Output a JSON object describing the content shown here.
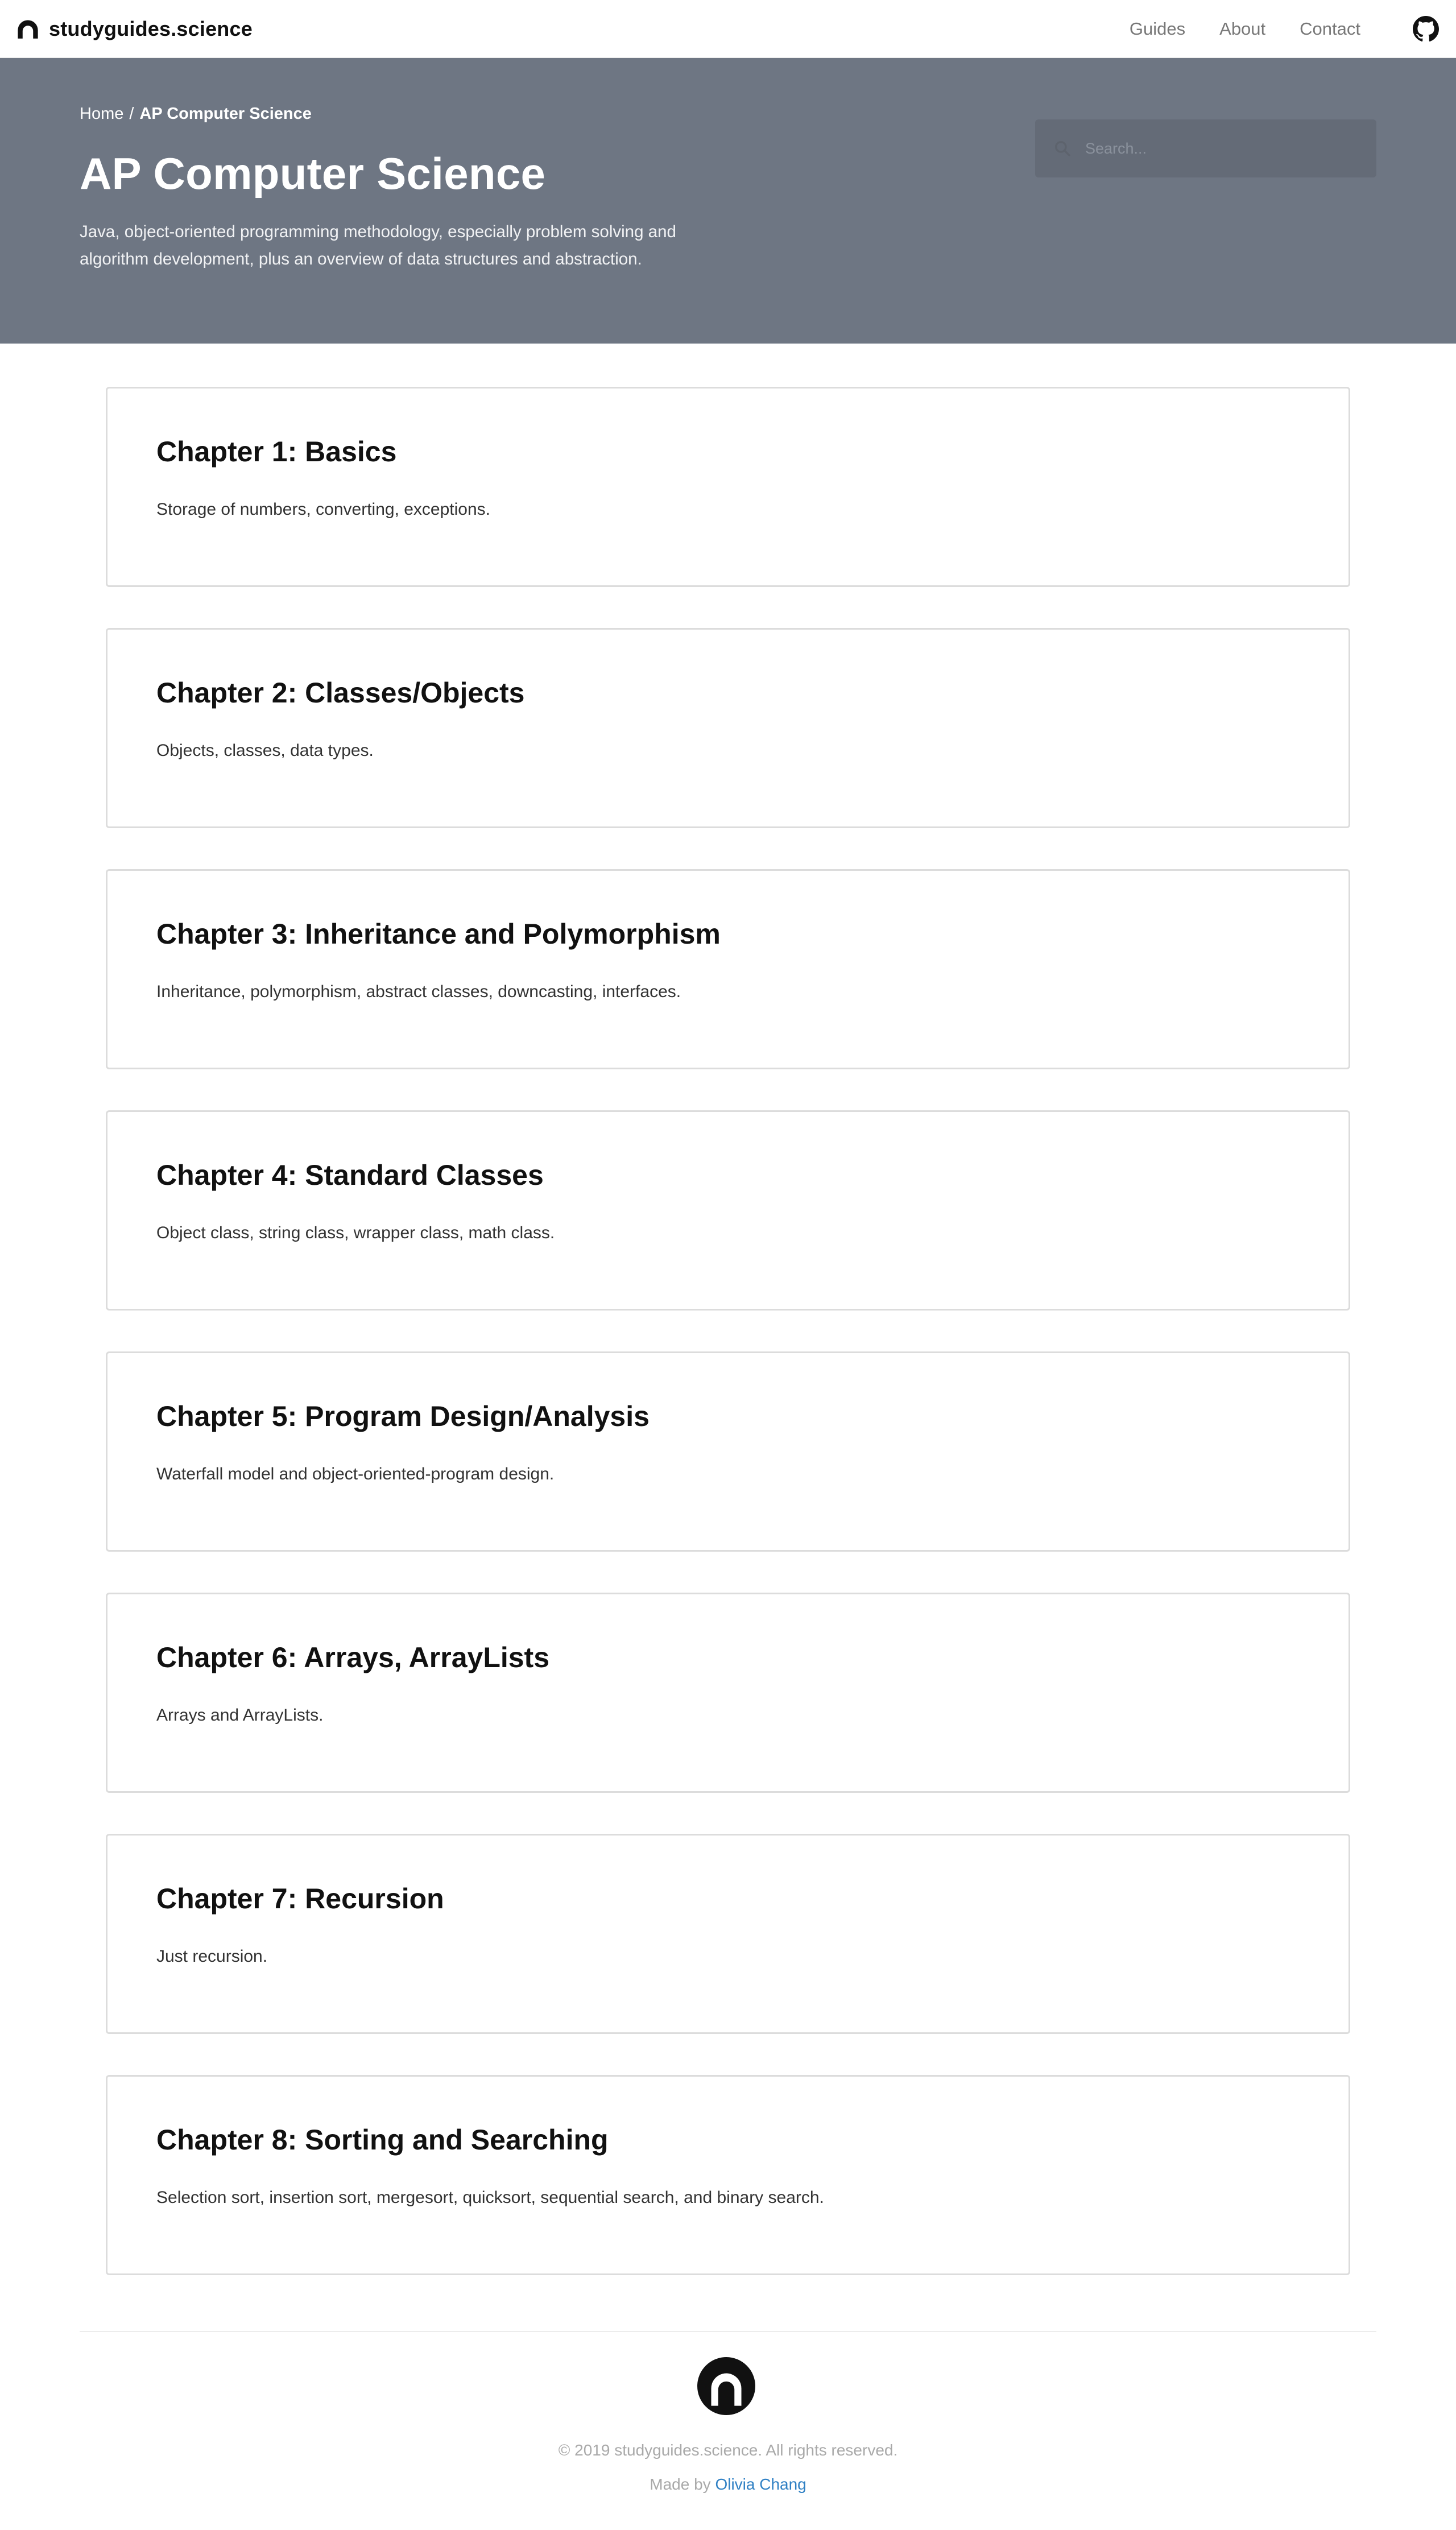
{
  "nav": {
    "brand": "studyguides.science",
    "links": [
      "Guides",
      "About",
      "Contact"
    ]
  },
  "hero": {
    "breadcrumb_home": "Home",
    "breadcrumb_sep": "/",
    "breadcrumb_current": "AP Computer Science",
    "title": "AP Computer Science",
    "description": "Java, object-oriented programming methodology, especially problem solving and algorithm development, plus an overview of data structures and abstraction.",
    "search_placeholder": "Search..."
  },
  "chapters": [
    {
      "title": "Chapter 1: Basics",
      "description": "Storage of numbers, converting, exceptions."
    },
    {
      "title": "Chapter 2: Classes/Objects",
      "description": "Objects, classes, data types."
    },
    {
      "title": "Chapter 3: Inheritance and Polymorphism",
      "description": "Inheritance, polymorphism, abstract classes, downcasting, interfaces."
    },
    {
      "title": "Chapter 4: Standard Classes",
      "description": "Object class, string class, wrapper class, math class."
    },
    {
      "title": "Chapter 5: Program Design/Analysis",
      "description": "Waterfall model and object-oriented-program design."
    },
    {
      "title": "Chapter 6: Arrays, ArrayLists",
      "description": "Arrays and ArrayLists."
    },
    {
      "title": "Chapter 7: Recursion",
      "description": "Just recursion."
    },
    {
      "title": "Chapter 8: Sorting and Searching",
      "description": "Selection sort, insertion sort, mergesort, quicksort, sequential search, and binary search."
    }
  ],
  "footer": {
    "copyright": "© 2019 studyguides.science. All rights reserved.",
    "made_by_prefix": "Made by",
    "author": "Olivia Chang"
  },
  "colors": {
    "hero_bg": "#6e7683",
    "link_blue": "#2f80c4"
  },
  "icons": [
    "studyguides-logo-icon",
    "github-icon",
    "search-icon"
  ]
}
